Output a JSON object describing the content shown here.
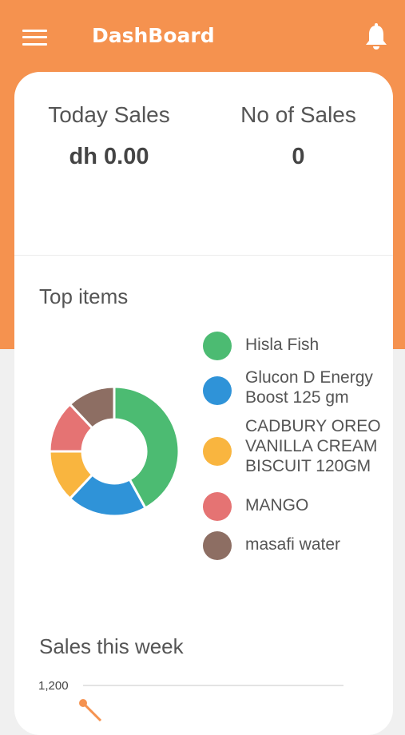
{
  "app": {
    "title": "DashBoard"
  },
  "icons": {
    "menu": "hamburger-menu-icon",
    "bell": "bell-icon"
  },
  "colors": {
    "accent": "#f5924f"
  },
  "summary": {
    "today_sales_label": "Today Sales",
    "today_sales_value": "dh 0.00",
    "no_of_sales_label": "No of Sales",
    "no_of_sales_value": "0"
  },
  "top_items": {
    "title": "Top items",
    "legend": [
      {
        "label": "Hisla Fish",
        "color": "#4cbb72"
      },
      {
        "label": "Glucon D Energy Boost 125 gm",
        "color": "#2f93d8"
      },
      {
        "label": "CADBURY OREO VANILLA CREAM BISCUIT 120GM",
        "color": "#f9b53f"
      },
      {
        "label": "MANGO",
        "color": "#e57373"
      },
      {
        "label": "masafi water",
        "color": "#8d6e63"
      }
    ]
  },
  "sales_week": {
    "title": "Sales this week",
    "y_tick": "1,200"
  },
  "chart_data": [
    {
      "type": "pie",
      "title": "Top items",
      "categories": [
        "Hisla Fish",
        "Glucon D Energy Boost 125 gm",
        "CADBURY OREO VANILLA CREAM BISCUIT 120GM",
        "MANGO",
        "masafi water"
      ],
      "values": [
        42,
        20,
        13,
        13,
        12
      ],
      "colors": [
        "#4cbb72",
        "#2f93d8",
        "#f9b53f",
        "#e57373",
        "#8d6e63"
      ],
      "donut": true
    },
    {
      "type": "line",
      "title": "Sales this week",
      "y_ticks": [
        1200
      ],
      "series": [
        {
          "values": [
            1200
          ],
          "color": "#f5924f"
        }
      ]
    }
  ]
}
